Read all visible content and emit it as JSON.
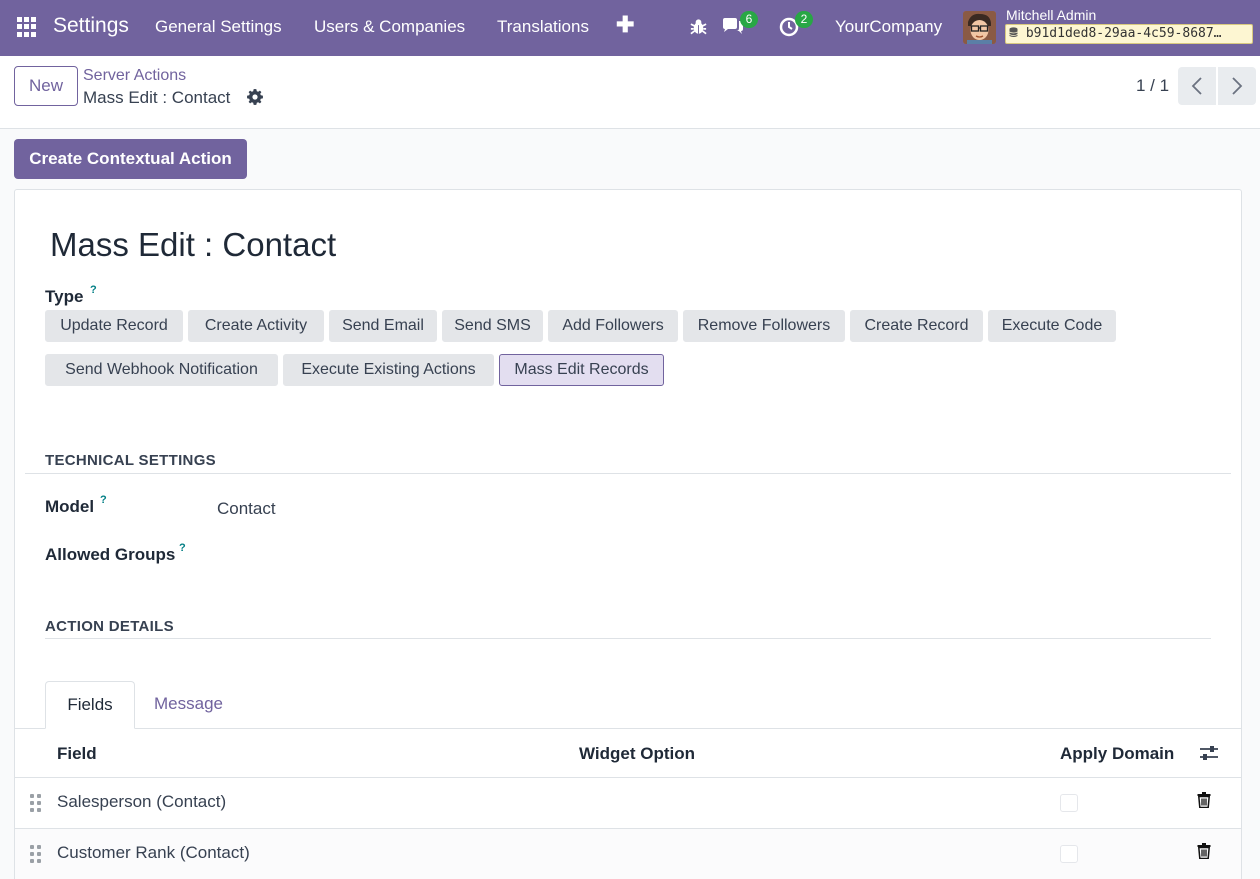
{
  "navbar": {
    "brand": "Settings",
    "menus": [
      "General Settings",
      "Users & Companies",
      "Translations"
    ],
    "plus_label": "✚",
    "chat_count": "6",
    "activity_count": "2",
    "company": "YourCompany",
    "user_name": "Mitchell Admin",
    "db_name": "b91d1ded8-29aa-4c59-8687…"
  },
  "control": {
    "new_label": "New",
    "breadcrumb_parent": "Server Actions",
    "breadcrumb_current": "Mass Edit : Contact",
    "pager": "1 / 1"
  },
  "main": {
    "primary_button": "Create Contextual Action",
    "record_title": "Mass Edit : Contact",
    "type_label": "Type",
    "help_mark": "?",
    "type_options": [
      "Update Record",
      "Create Activity",
      "Send Email",
      "Send SMS",
      "Add Followers",
      "Remove Followers",
      "Create Record",
      "Execute Code",
      "Send Webhook Notification",
      "Execute Existing Actions",
      "Mass Edit Records"
    ],
    "selected_type": "Mass Edit Records",
    "technical_title": "TECHNICAL SETTINGS",
    "model_label": "Model",
    "model_value": "Contact",
    "groups_label": "Allowed Groups",
    "action_title": "ACTION DETAILS"
  },
  "tabs": [
    "Fields",
    "Message"
  ],
  "table": {
    "columns": [
      "Field",
      "Widget Option",
      "Apply Domain"
    ],
    "rows": [
      {
        "field": "Salesperson (Contact)",
        "widget_option": "",
        "apply_domain": false
      },
      {
        "field": "Customer Rank (Contact)",
        "widget_option": "",
        "apply_domain": false
      }
    ]
  },
  "colors": {
    "brand": "#71639e",
    "success_badge": "#28a745",
    "help": "#017e84"
  }
}
